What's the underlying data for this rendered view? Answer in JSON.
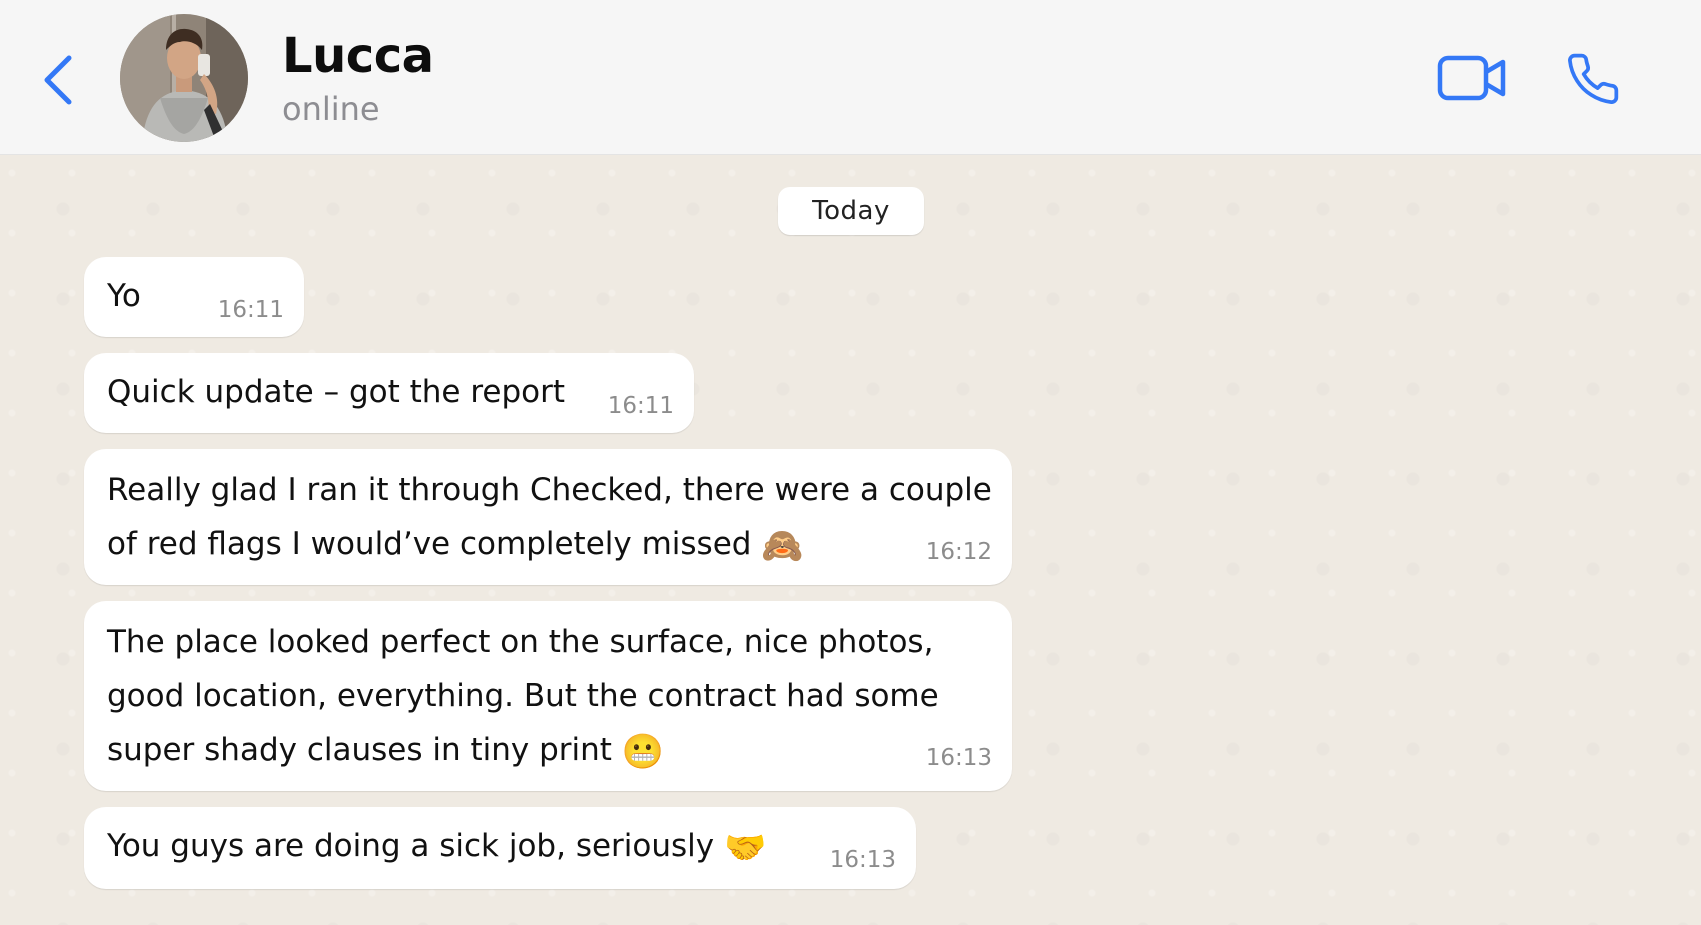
{
  "header": {
    "contact_name": "Lucca",
    "status": "online"
  },
  "chat": {
    "date_label": "Today",
    "messages": [
      {
        "lines": [
          "Yo"
        ],
        "time": "16:11"
      },
      {
        "lines": [
          "Quick update – got the report"
        ],
        "time": "16:11"
      },
      {
        "lines": [
          "Really glad I ran it through Checked, there were a couple",
          "of red flags I would’ve completely missed"
        ],
        "emoji": "🙈",
        "time": "16:12"
      },
      {
        "lines": [
          "The place looked perfect on the surface, nice photos,",
          "good location, everything. But the contract had some",
          "super shady clauses in tiny print"
        ],
        "emoji": "😬",
        "time": "16:13"
      },
      {
        "lines": [
          "You guys are doing a sick job, seriously"
        ],
        "emoji": "🤝",
        "time": "16:13"
      }
    ]
  },
  "colors": {
    "accent": "#3478f6",
    "header_bg": "#f6f6f6",
    "chat_bg": "#efeae2",
    "bubble_bg": "#ffffff",
    "status_text": "#8d8d92",
    "time_text": "#8c8c8c"
  },
  "icons": {
    "back": "chevron-left-icon",
    "video": "video-camera-icon",
    "call": "phone-icon"
  }
}
